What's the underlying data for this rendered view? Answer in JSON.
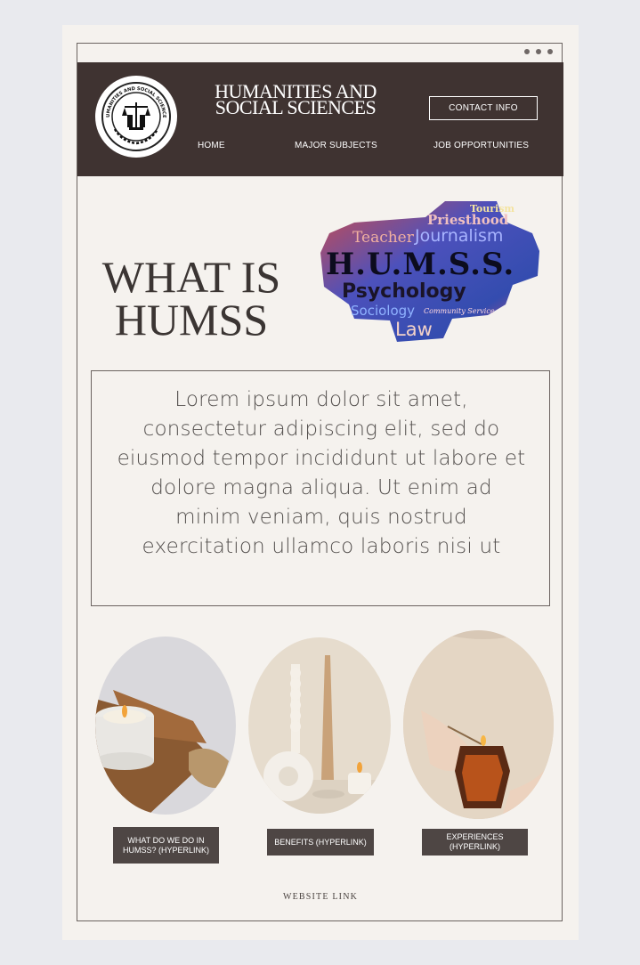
{
  "window": {
    "controls": [
      "dot",
      "dot",
      "dot"
    ]
  },
  "header": {
    "logo_text": "HUMANITIES AND SOCIAL SCIENCES",
    "title_line1": "HUMANITIES AND",
    "title_line2": "SOCIAL SCIENCES",
    "contact_label": "CONTACT INFO",
    "nav": [
      "HOME",
      "MAJOR SUBJECTS",
      "JOB OPPORTUNITIES"
    ]
  },
  "hero": {
    "title_line1": "WHAT IS",
    "title_line2": "HUMSS"
  },
  "wordcloud": {
    "words": [
      "Tourism",
      "Priesthood",
      "Teacher",
      "Journalism",
      "H.U.M.S.S.",
      "Psychology",
      "Sociology",
      "Community Service",
      "Law"
    ]
  },
  "intro": {
    "text": "Lorem ipsum dolor sit amet, consectetur adipiscing elit, sed do eiusmod tempor incididunt ut labore et dolore magna aliqua. Ut enim ad minim veniam, quis nostrud exercitation ullamco laboris nisi ut"
  },
  "cards": [
    {
      "caption": "WHAT DO WE DO IN HUMSS? (HYPERLINK)"
    },
    {
      "caption": "BENEFITS (HYPERLINK)"
    },
    {
      "caption": "EXPERIENCES (HYPERLINK)"
    }
  ],
  "footer": {
    "link_label": "WEBSITE LINK"
  },
  "colors": {
    "header_bg": "#3f3331",
    "page_bg": "#f5f2ee",
    "caption_bg": "#4e4644"
  }
}
